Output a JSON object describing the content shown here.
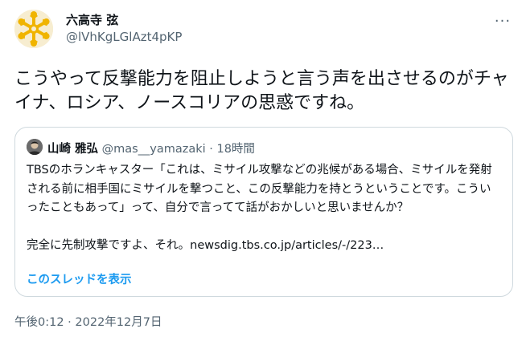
{
  "author": {
    "display_name": "六高寺 弦",
    "handle": "@lVhKgLGlAzt4pKP",
    "avatar_icon": "snowflake-avatar-icon",
    "avatar_color": "#f0b400"
  },
  "tweet": {
    "text": "こうやって反撃能力を阻止しようと言う声を出させるのがチャイナ、ロシア、ノースコリアの思惑ですね。",
    "timestamp": "午後0:12",
    "date": "2022年12月7日",
    "separator": "·"
  },
  "quote": {
    "display_name": "山崎 雅弘",
    "handle": "@mas__yamazaki",
    "separator": "·",
    "time_ago": "18時間",
    "paragraph1": "TBSのホランキャスター「これは、ミサイル攻撃などの兆候がある場合、ミサイルを発射される前に相手国にミサイルを撃つこと、この反撃能力を持とうということです。こういったこともあって」って、自分で言ってて話がおかしいと思いませんか？",
    "paragraph2": "完全に先制攻撃ですよ、それ。newsdig.tbs.co.jp/articles/-/223…",
    "show_thread": "このスレッドを表示"
  },
  "colors": {
    "link": "#1d9bf0",
    "secondary_text": "#536471",
    "border": "#cfd9de"
  }
}
